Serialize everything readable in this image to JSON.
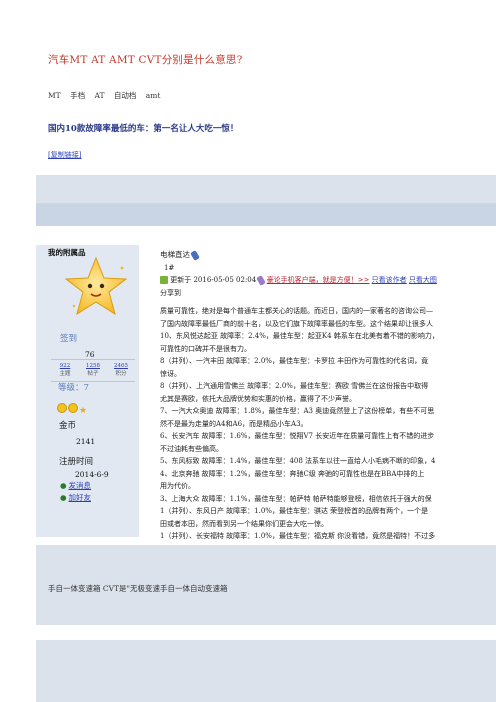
{
  "page": {
    "title": "汽车MT AT AMT CVT分别是什么意思?",
    "tags": [
      "MT",
      "手档",
      "AT",
      "自动档",
      "amt"
    ],
    "headline": "国内10款故障率最低的车：第一名让人大吃一惊！",
    "copy_link": "[复制链接]"
  },
  "sidebar": {
    "title": "我的附属品",
    "checkin": "签到",
    "uid": "76",
    "stats": [
      {
        "value": "922",
        "label": "主题"
      },
      {
        "value": "1258",
        "label": "帖子"
      },
      {
        "value": "2465",
        "label": "积分"
      }
    ],
    "level": "等级：7",
    "gold_label": "金币",
    "gold_value": "2141",
    "reg_label": "注册时间",
    "reg_value": "2014-6-9",
    "links": [
      "发消息",
      "加好友"
    ]
  },
  "post": {
    "author": "电梯直达",
    "floor": "1#",
    "updated": "更新于  2016-05-05 02:04",
    "client_link": "豪论手机客户端，就是方便！>>",
    "author_only": "只看该作者",
    "big_image": "只看大图",
    "share": "分享到",
    "lines": [
      "质量可靠性，绝对是每个普通车主都关心的话题。而近日，国内的一家著名的咨询公司—",
      "了国内故障率最低厂商的前十名，以及它们旗下故障率最低的车型。这个结果却让很多人",
      "10、东风悦达起亚  故障率：2.4%，最佳车型：起亚K4  韩系车在北美有着不错的影响力，",
      "可靠性的口碑并不是很有力。",
      "8（并列）、一汽丰田  故障率：2.0%，最佳车型：卡罗拉  丰田作为可靠性的代名词，竟",
      "惊讶。",
      "8（并列）、上汽通用雪佛兰  故障率：2.0%，最佳车型：赛欧  雪佛兰在这份报告中取得",
      "尤其是赛欧，依托大品牌优势和实惠的价格，赢得了不少声誉。",
      "7、一汽大众奥迪  故障率：1.8%，最佳车型：A3  奥迪竟然登上了这份榜单，有些不可思",
      "然不是最为走量的A4和A6，而是精品小车A3。",
      "6、长安汽车  故障率：1.6%，最佳车型：悦翔V7  长安近年在质量可靠性上有不错的进步",
      "不过油耗有些偏高。",
      "5、东风标致  故障率：1.4%，最佳车型：408  法系车以往一直给人小毛病不断的印象，4",
      "4、北京奔驰  故障率：1.2%，最佳车型：奔驰C级  奔驰的可靠性也是在BBA中排的上",
      "用为代价。",
      "3、上海大众  故障率：1.1%，最佳车型：帕萨特  帕萨特能够登榜，相信依托于强大的保",
      "1（并列）、东风日产  故障率：1.0%，最佳车型：骐达  荣登榜首的品牌有两个，一个是",
      "田或者本田，然而看到另一个结果你们更会大吃一惊。",
      "1（并列）、长安福特  故障率：1.0%，最佳车型：福克斯  你没看错，竟然是福特！不过多"
    ]
  },
  "footer": "手自一体变速箱  CVT是\"无极变速手自一体自动变速箱"
}
